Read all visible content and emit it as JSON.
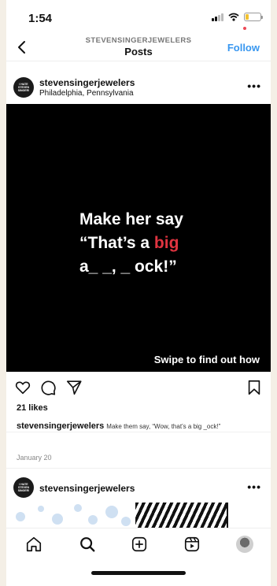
{
  "status_bar": {
    "time": "1:54",
    "battery_level": 0.2,
    "battery_color": "#f2c230"
  },
  "header": {
    "account_handle": "STEVENSINGERJEWELERS",
    "title": "Posts",
    "follow_label": "Follow",
    "accent": "#3897f0"
  },
  "post": {
    "avatar_text": "I HATE STEVEN SINGER!",
    "username": "stevensingerjewelers",
    "location": "Philadelphia, Pennsylvania",
    "image": {
      "line1": "Make her say",
      "line2_start": "“That’s a ",
      "line2_highlight": "big",
      "line3": "a_ _, _ ock!”",
      "highlight_color": "#e03440",
      "swipe_text": "Swipe to find out how"
    },
    "likes": "21 likes",
    "caption_user": "stevensingerjewelers",
    "caption_text": "Make them say, “Wow, that’s a big _ock!”",
    "date": "January 20"
  },
  "post2": {
    "avatar_text": "I HATE STEVEN SINGER!",
    "username": "stevensingerjewelers"
  },
  "icons": {
    "back": "chevron-left-icon",
    "more": "more-horizontal-icon",
    "like": "heart-icon",
    "comment": "comment-icon",
    "share": "send-icon",
    "save": "bookmark-icon",
    "tabs": [
      "home-icon",
      "search-icon",
      "add-post-icon",
      "reels-icon",
      "profile-avatar"
    ]
  }
}
